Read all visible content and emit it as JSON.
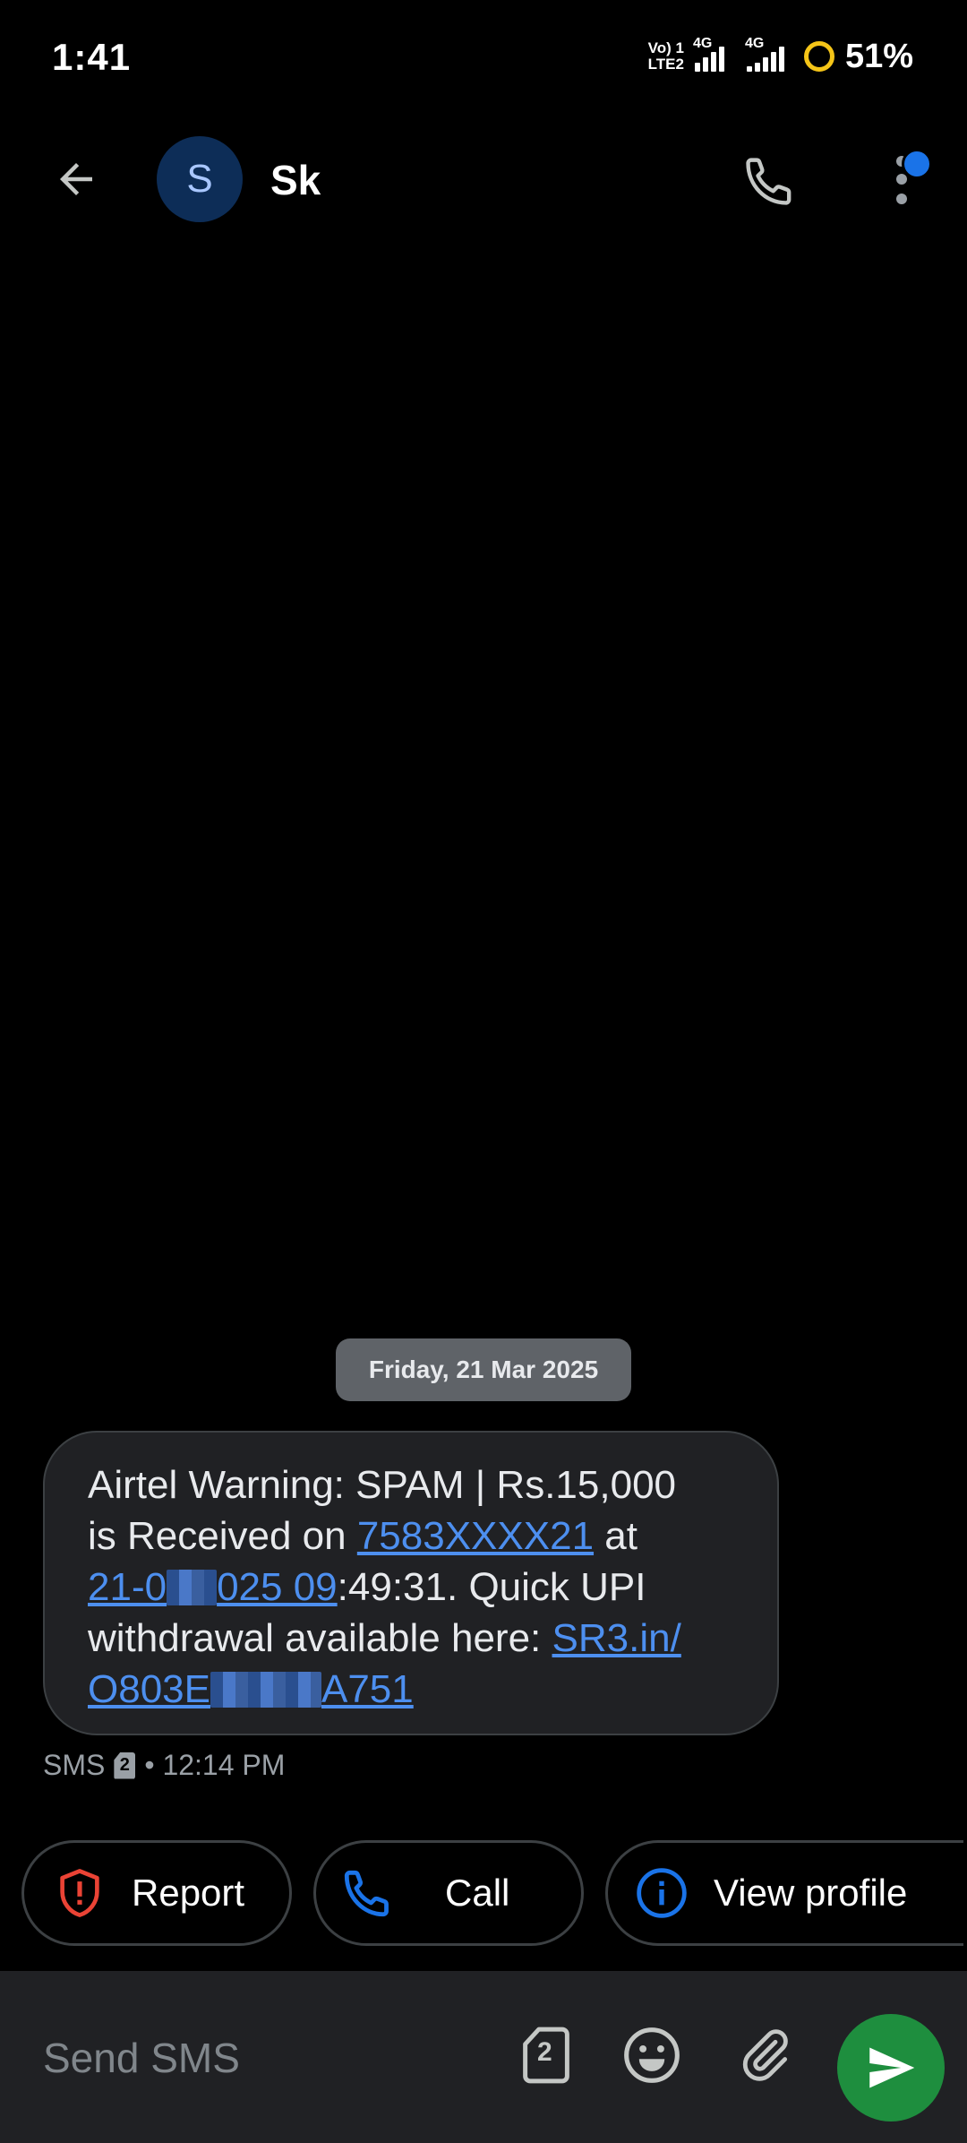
{
  "status_bar": {
    "time": "1:41",
    "volte_line1": "Vo) 1",
    "volte_line2": "LTE2",
    "net1": "4G",
    "net2": "4G",
    "battery": "51%"
  },
  "header": {
    "avatar_letter": "S",
    "contact_name": "Sk"
  },
  "conversation": {
    "date_chip": "Friday, 21 Mar 2025",
    "message": {
      "line1": "Airtel Warning: SPAM | Rs.15,000",
      "line2_pre": "is Received on ",
      "line2_link": "7583XXXX21",
      "line2_post": " at",
      "line3_link_a": "21-0",
      "line3_link_b": "025 09",
      "line3_post": ":49:31. Quick UPI",
      "line4_pre": "withdrawal available here: ",
      "line4_link": "SR3.in/",
      "line5_link_a": "O803E",
      "line5_link_b": "A751"
    },
    "meta_type": "SMS",
    "meta_sim": "2",
    "meta_time": "• 12:14 PM"
  },
  "actions": {
    "report": "Report",
    "call": "Call",
    "view_profile": "View profile"
  },
  "compose": {
    "placeholder": "Send SMS",
    "sim_number": "2"
  },
  "colors": {
    "accent_blue": "#1a73e8",
    "link_blue": "#4d8fef",
    "report_red": "#ea4335",
    "send_green": "#1e8e3e"
  }
}
